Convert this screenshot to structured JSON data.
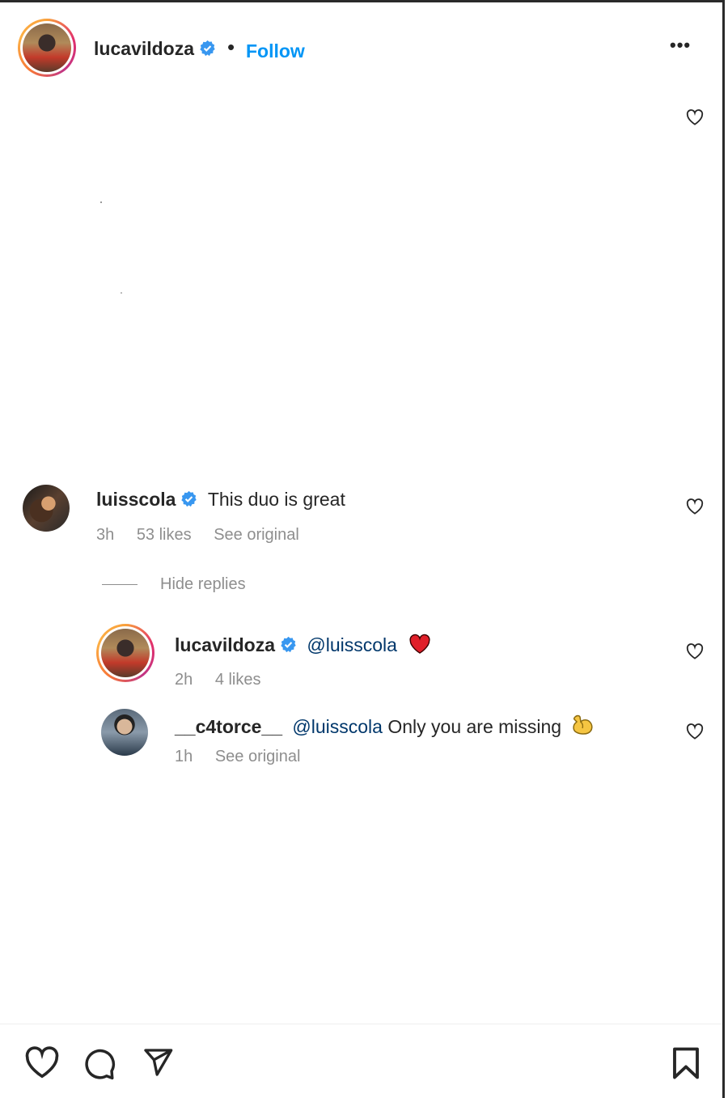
{
  "post": {
    "author": "lucavildoza",
    "separator": "•",
    "follow_label": "Follow",
    "more_label": "•••"
  },
  "comments": [
    {
      "username": "luisscola",
      "text": "This duo is great",
      "time": "3h",
      "likes": "53 likes",
      "see_original": "See original"
    }
  ],
  "hide_replies_label": "Hide replies",
  "replies": [
    {
      "username": "lucavildoza",
      "mention": "@luisscola",
      "emoji": "❤️",
      "time": "2h",
      "likes": "4 likes"
    },
    {
      "username": "__c4torce__",
      "mention": "@luisscola",
      "text": "Only you are missing",
      "emoji": "💪",
      "time": "1h",
      "see_original": "See original"
    }
  ],
  "colors": {
    "follow": "#0095f6",
    "mention": "#00376b",
    "meta": "#8e8e8e",
    "verified": "#3897f0"
  },
  "icons": [
    "verified-badge-icon",
    "heart-icon",
    "comment-icon",
    "share-icon",
    "bookmark-icon",
    "more-icon"
  ]
}
